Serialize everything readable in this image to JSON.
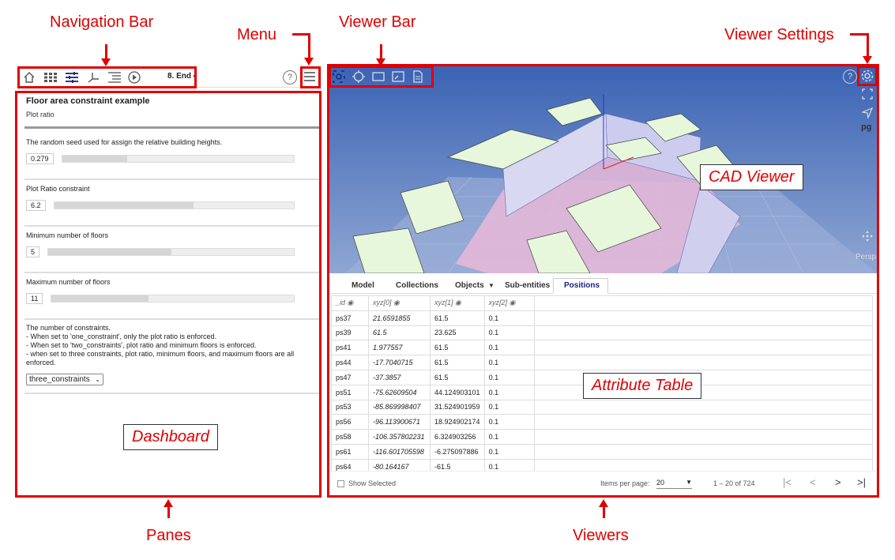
{
  "annotations": {
    "navigation_bar": "Navigation Bar",
    "menu": "Menu",
    "viewer_bar": "Viewer Bar",
    "viewer_settings": "Viewer Settings",
    "cad_viewer": "CAD Viewer",
    "attribute_table": "Attribute Table",
    "dashboard": "Dashboard",
    "panes": "Panes",
    "viewers": "Viewers"
  },
  "nav": {
    "step": "8. End",
    "icons": [
      "home-icon",
      "grid-icon",
      "sliders-icon",
      "axes-icon",
      "indent-icon",
      "play-icon"
    ]
  },
  "dashboard": {
    "title": "Floor area constraint example",
    "subtitle": "Plot ratio",
    "params": [
      {
        "label": "The random seed used for assign the relative building heights.",
        "value": "0.279",
        "level": 0.28
      },
      {
        "label": "Plot Ratio constraint",
        "value": "6.2",
        "level": 0.58
      },
      {
        "label": "Minimum number of floors",
        "value": "5",
        "level": 0.5
      },
      {
        "label": "Maximum number of floors",
        "value": "11",
        "level": 0.4
      }
    ],
    "description": [
      "The number of constraints.",
      "- When set to 'one_constraint', only the plot ratio is enforced.",
      "- When set to 'two_constraints', plot ratio and minimum floors is enforced.",
      "- when set to three constraints, plot ratio, minimum floors, and maximum floors are all enforced."
    ],
    "select_value": "three_constraints"
  },
  "viewer": {
    "side_label_pg": "pg",
    "side_label_persp": "Persp"
  },
  "attribute_table": {
    "tabs": [
      "Model",
      "Collections",
      "Objects",
      "Sub-entities",
      "Positions"
    ],
    "active_tab": "Positions",
    "columns": [
      "_id",
      "xyz[0]",
      "xyz[1]",
      "xyz[2]"
    ],
    "rows": [
      [
        "ps37",
        "21.6591855",
        "61.5",
        "0.1"
      ],
      [
        "ps39",
        "61.5",
        "23.625",
        "0.1"
      ],
      [
        "ps41",
        "1.977557",
        "61.5",
        "0.1"
      ],
      [
        "ps44",
        "-17.7040715",
        "61.5",
        "0.1"
      ],
      [
        "ps47",
        "-37.3857",
        "61.5",
        "0.1"
      ],
      [
        "ps51",
        "-75.62609504",
        "44.124903101",
        "0.1"
      ],
      [
        "ps53",
        "-85.869998407",
        "31.524901959",
        "0.1"
      ],
      [
        "ps56",
        "-96.113900671",
        "18.924902174",
        "0.1"
      ],
      [
        "ps58",
        "-106.357802231",
        "6.324903256",
        "0.1"
      ],
      [
        "ps61",
        "-116.601705598",
        "-6.275097886",
        "0.1"
      ],
      [
        "ps64",
        "-80.164167",
        "-61.5",
        "0.1"
      ]
    ],
    "footer": {
      "show_selected": "Show Selected",
      "items_per_page_label": "Items per page:",
      "items_per_page": "20",
      "range": "1 – 20 of 724"
    }
  },
  "colors": {
    "annotation_red": "#e00000",
    "sky_top": "#3b63b4",
    "building_green": "#e6f7dc",
    "ground_pink": "#e7b8d8"
  }
}
